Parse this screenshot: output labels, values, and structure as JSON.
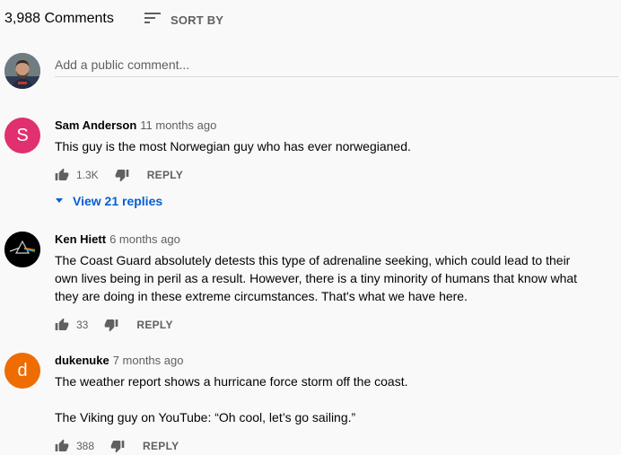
{
  "header": {
    "comment_count": "3,988 Comments",
    "sort_label": "SORT BY",
    "sort_icon": "sort-icon"
  },
  "add_comment": {
    "placeholder": "Add a public comment...",
    "avatar": "user-avatar"
  },
  "comments": [
    {
      "avatar_letter": "S",
      "avatar_color": "#e0306f",
      "author": "Sam Anderson",
      "time": "11 months ago",
      "text": "This guy is the most Norwegian guy who has ever norwegianed.",
      "likes": "1.3K",
      "reply_label": "REPLY",
      "view_replies": "View 21 replies"
    },
    {
      "avatar_letter": "",
      "avatar_color": "#000000",
      "author": "Ken Hiett",
      "time": "6 months ago",
      "text": "The Coast Guard absolutely detests this type of adrenaline seeking, which could lead to their own lives being in peril as a result. However, there is a tiny minority of humans that know what they are doing in these extreme circumstances. That's what we have here.",
      "likes": "33",
      "reply_label": "REPLY"
    },
    {
      "avatar_letter": "d",
      "avatar_color": "#ef6c00",
      "author": "dukenuke",
      "time": "7 months ago",
      "text": "The weather report shows a hurricane force storm off the coast.\n\nThe Viking guy on YouTube: “Oh cool, let’s go sailing.”",
      "likes": "388",
      "reply_label": "REPLY"
    }
  ]
}
